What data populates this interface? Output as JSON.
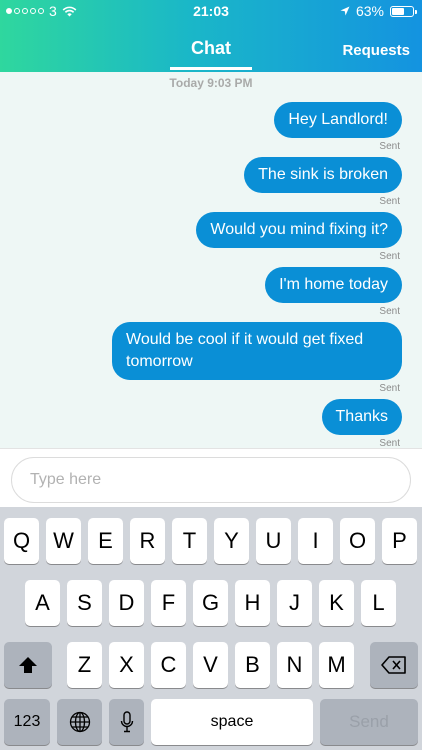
{
  "status_bar": {
    "carrier": "3",
    "time": "21:03",
    "battery": "63%",
    "battery_level": 0.63
  },
  "header": {
    "active_tab": "Chat",
    "requests_label": "Requests"
  },
  "conversation": {
    "timestamp": "Today 9:03 PM",
    "messages": [
      {
        "text": "Hey Landlord!",
        "status": "Sent"
      },
      {
        "text": "The sink is broken",
        "status": "Sent"
      },
      {
        "text": "Would you mind fixing it?",
        "status": "Sent"
      },
      {
        "text": "I'm home today",
        "status": "Sent"
      },
      {
        "text": "Would be cool if it would get fixed tomorrow",
        "status": "Sent"
      },
      {
        "text": "Thanks",
        "status": "Sent"
      }
    ]
  },
  "composer": {
    "placeholder": "Type here",
    "value": ""
  },
  "keyboard": {
    "row1": [
      "Q",
      "W",
      "E",
      "R",
      "T",
      "Y",
      "U",
      "I",
      "O",
      "P"
    ],
    "row2": [
      "A",
      "S",
      "D",
      "F",
      "G",
      "H",
      "J",
      "K",
      "L"
    ],
    "row3": [
      "Z",
      "X",
      "C",
      "V",
      "B",
      "N",
      "M"
    ],
    "numbers_label": "123",
    "space_label": "space",
    "send_label": "Send"
  },
  "colors": {
    "bubble": "#0a8fd6",
    "header_gradient_start": "#2fd79e",
    "header_gradient_end": "#1493e0"
  }
}
